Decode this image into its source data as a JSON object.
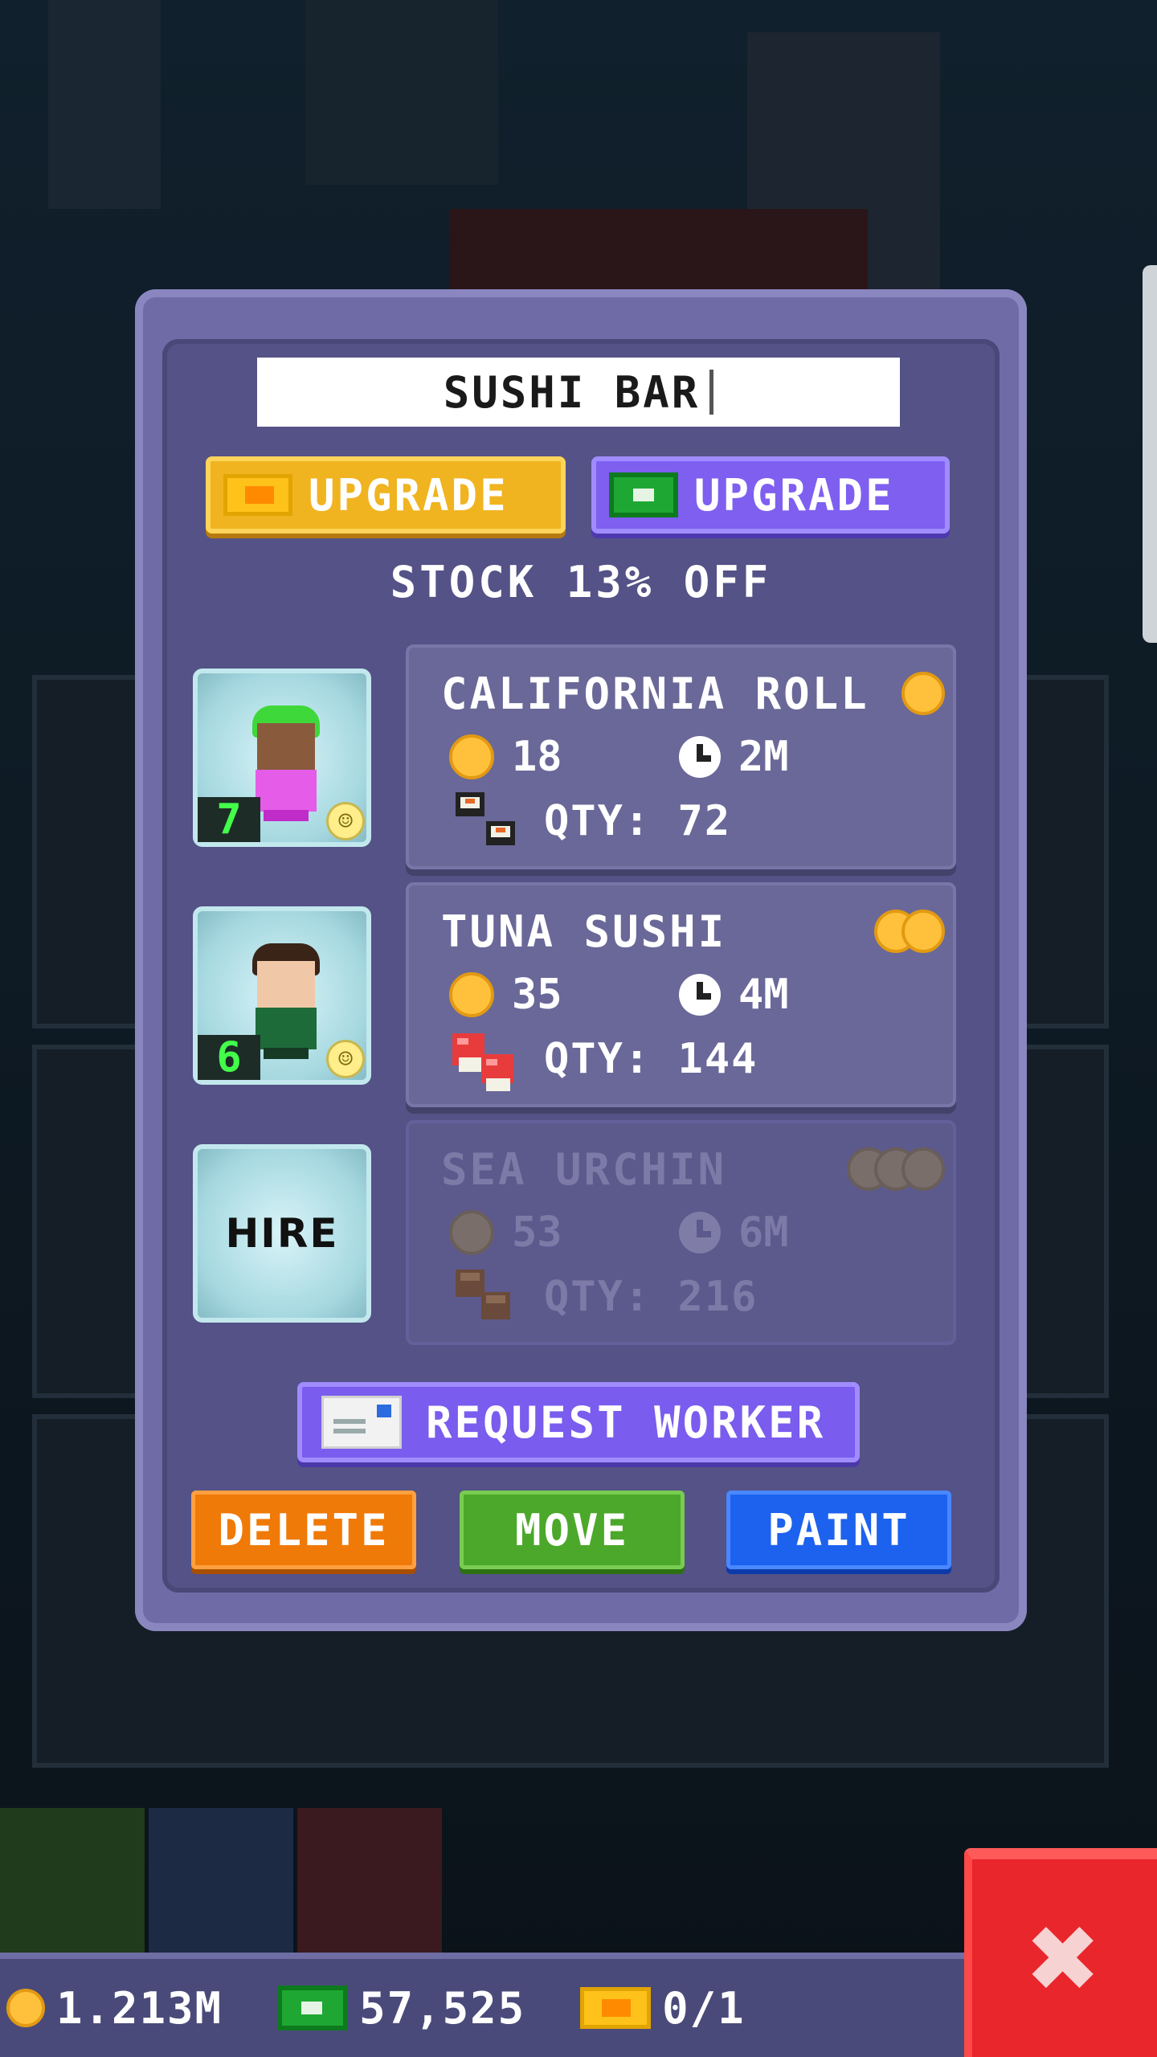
{
  "panel": {
    "building_name": "SUSHI BAR",
    "upgrade_ticket_label": "UPGRADE",
    "upgrade_cash_label": "UPGRADE",
    "stock_discount": "STOCK 13% OFF",
    "request_worker_label": "REQUEST WORKER",
    "hire_label": "HIRE",
    "actions": {
      "delete": "DELETE",
      "move": "MOVE",
      "paint": "PAINT"
    }
  },
  "workers": [
    {
      "level": "7",
      "hair_color": "#3fd83a",
      "shirt_color": "#e45ce8",
      "skin_color": "#8a5a3c"
    },
    {
      "level": "6",
      "hair_color": "#3a2418",
      "shirt_color": "#1e6b3a",
      "skin_color": "#f0c8a8"
    }
  ],
  "products": [
    {
      "name": "CALIFORNIA ROLL",
      "price": "18",
      "time": "2M",
      "qty": "QTY: 72",
      "tier_coins": 1,
      "locked": false
    },
    {
      "name": "TUNA SUSHI",
      "price": "35",
      "time": "4M",
      "qty": "QTY: 144",
      "tier_coins": 2,
      "locked": false
    },
    {
      "name": "SEA URCHIN",
      "price": "53",
      "time": "6M",
      "qty": "QTY: 216",
      "tier_coins": 3,
      "locked": true
    }
  ],
  "status_bar": {
    "coins": "1.213M",
    "bux": "57,525",
    "tickets": "0/1"
  },
  "colors": {
    "coin": "#ffc13b",
    "bux": "#1ea833",
    "ticket": "#ffc21a",
    "delete": "#f07a08",
    "move": "#4ca82a",
    "paint": "#1c62ee",
    "close": "#e8262c"
  },
  "icons": {
    "close": "close-icon",
    "coin": "coin-icon",
    "bux": "bux-icon",
    "ticket": "ticket-icon",
    "clock": "clock-icon",
    "envelope": "envelope-icon"
  }
}
